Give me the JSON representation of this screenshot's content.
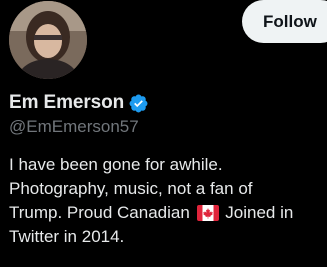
{
  "profile": {
    "display_name": "Em Emerson",
    "handle": "@EmEmerson57",
    "verified": true,
    "verified_color": "#1d9bf0",
    "avatar_icon": "profile-photo"
  },
  "actions": {
    "follow_label": "Follow"
  },
  "bio": {
    "line1": "I have been gone for awhile.",
    "line2": "Photography, music, not a fan of",
    "line3_before_flag": "Trump. Proud Canadian",
    "flag_icon": "canada-flag-icon",
    "line3_after_flag": "Joined in",
    "line4": "Twitter in 2014."
  },
  "colors": {
    "background": "#000000",
    "text_primary": "#e7e9ea",
    "text_secondary": "#71767b",
    "button_bg": "#eff3f4",
    "button_text": "#0f1419"
  }
}
